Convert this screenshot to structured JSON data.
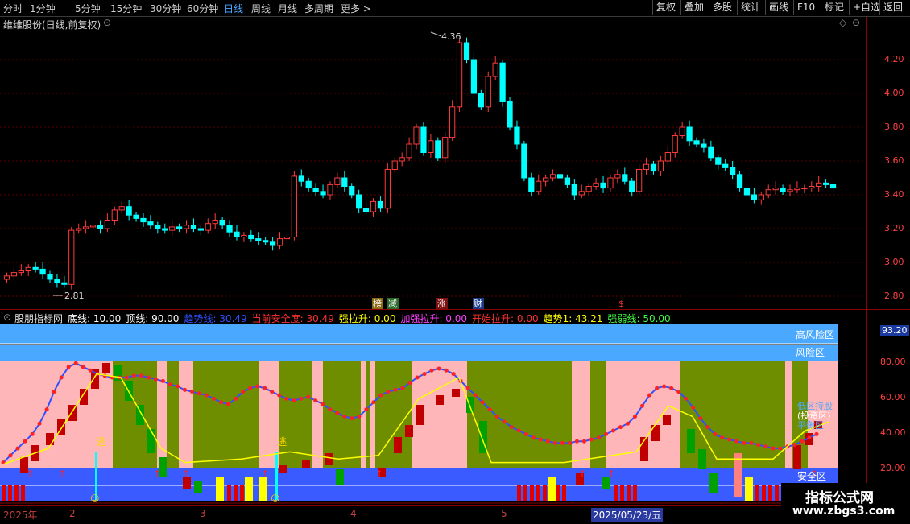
{
  "toolbar": {
    "periods": [
      "分时",
      "1分钟",
      "5分钟",
      "15分钟",
      "30分钟",
      "60分钟",
      "日线",
      "周线",
      "月线",
      "多周期",
      "更多 >"
    ],
    "active_period": "日线",
    "right_buttons": [
      "复权",
      "叠加",
      "多股",
      "统计",
      "画线",
      "F10",
      "标记",
      "+自选",
      "返回"
    ]
  },
  "kline": {
    "title": "维维股份(日线,前复权)",
    "high_label": "4.36",
    "low_label": "2.81",
    "y_ticks": [
      "4.20",
      "4.00",
      "3.80",
      "3.60",
      "3.40",
      "3.20",
      "3.00",
      "2.80"
    ],
    "event_tags": [
      "榜",
      "减",
      "涨",
      "财",
      "$"
    ]
  },
  "indicator": {
    "name": "股朋指标网",
    "params": [
      {
        "label": "底线",
        "value": "10.00",
        "color": "#ffffff"
      },
      {
        "label": "顶线",
        "value": "90.00",
        "color": "#ffffff"
      },
      {
        "label": "趋势线",
        "value": "30.49",
        "color": "#3050ff"
      },
      {
        "label": "当前安全度",
        "value": "30.49",
        "color": "#ff3030"
      },
      {
        "label": "强拉升",
        "value": "0.00",
        "color": "#ffff00"
      },
      {
        "label": "加强拉升",
        "value": "0.00",
        "color": "#ff40ff"
      },
      {
        "label": "开始拉升",
        "value": "0.00",
        "color": "#ff3030"
      },
      {
        "label": "趋势1",
        "value": "43.21",
        "color": "#ffff00"
      },
      {
        "label": "强弱线",
        "value": "50.00",
        "color": "#40ff40"
      }
    ],
    "zone_labels": {
      "high_risk": "高风险区",
      "risk": "风险区",
      "safe": "安全区",
      "low_invest": "低区持股",
      "invest": "(投资区)",
      "cost": "平衡区"
    },
    "escape_label": "逃",
    "y_ticks": [
      "93.20",
      "80.00",
      "60.00",
      "40.00",
      "20.00"
    ]
  },
  "dates": [
    "2025年",
    "2",
    "3",
    "4",
    "5",
    "2025/05/23/五"
  ],
  "watermark": {
    "line1": "指标公式网",
    "line2": "www.zbgs3.com"
  },
  "colors": {
    "up": "#ff3b3b",
    "down": "#00ffff",
    "grid": "#8b0000",
    "pink": "#ffb6b9",
    "olive": "#6e8e00",
    "blue": "#3a5bff",
    "lightblue": "#4aa8ff"
  }
}
